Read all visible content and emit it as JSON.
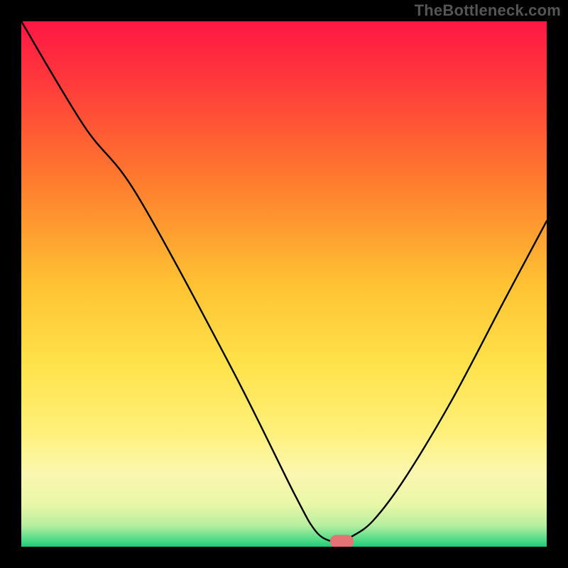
{
  "watermark": "TheBottleneck.com",
  "chart_data": {
    "type": "line",
    "title": "",
    "xlabel": "",
    "ylabel": "",
    "xlim": [
      0,
      100
    ],
    "ylim": [
      0,
      100
    ],
    "grid": false,
    "background_gradient_stops": [
      {
        "pct": 0,
        "color": "#ff1744"
      },
      {
        "pct": 12,
        "color": "#ff3b3b"
      },
      {
        "pct": 30,
        "color": "#ff7a2e"
      },
      {
        "pct": 50,
        "color": "#ffc233"
      },
      {
        "pct": 65,
        "color": "#ffe24a"
      },
      {
        "pct": 78,
        "color": "#fff07a"
      },
      {
        "pct": 86,
        "color": "#fbf7b0"
      },
      {
        "pct": 92,
        "color": "#e9f7a8"
      },
      {
        "pct": 96,
        "color": "#b6eea0"
      },
      {
        "pct": 99,
        "color": "#44d884"
      },
      {
        "pct": 100,
        "color": "#1ec877"
      }
    ],
    "series": [
      {
        "name": "bottleneck-curve",
        "color": "#000000",
        "x": [
          0,
          12,
          22,
          40,
          52,
          56,
          59,
          60.5,
          63,
          67,
          73,
          82,
          92,
          100
        ],
        "y": [
          100,
          80,
          67,
          34,
          10,
          3,
          1,
          1,
          2,
          5,
          13,
          28,
          47,
          62
        ]
      }
    ],
    "marker": {
      "name": "optimal-point",
      "x": 61,
      "y": 1,
      "width": 4.5,
      "height": 2.5,
      "color": "#e57373",
      "rx": 1.2
    }
  }
}
